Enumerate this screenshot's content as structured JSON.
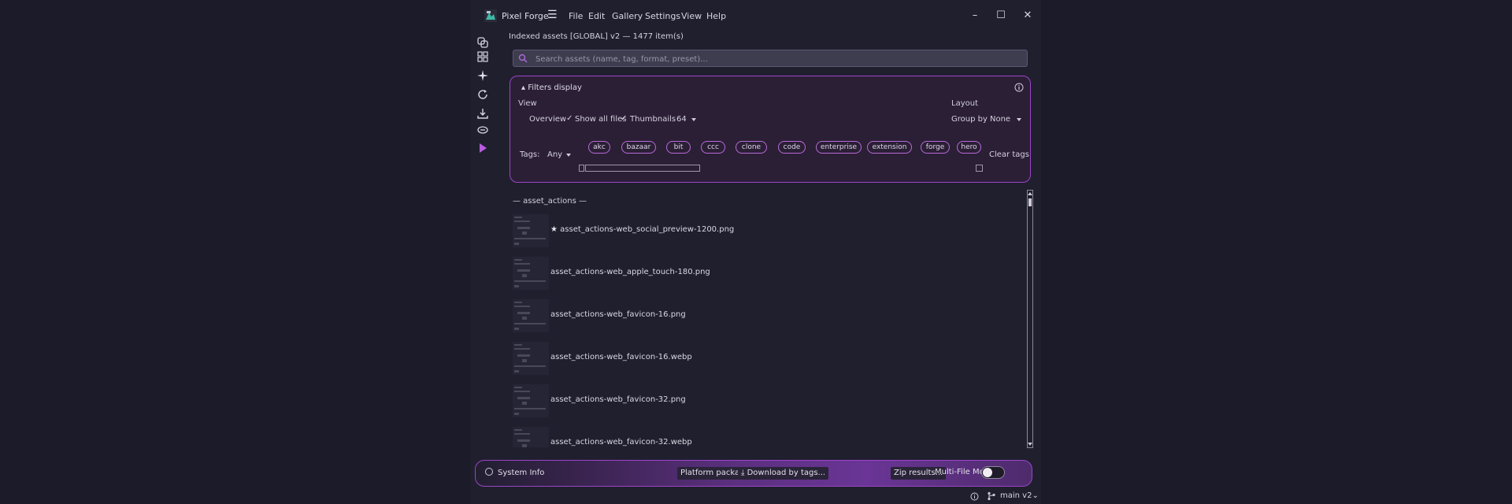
{
  "app": {
    "name": "Pixel Forge",
    "menu": [
      "File",
      "Edit",
      "Gallery",
      "Settings",
      "View",
      "Help"
    ],
    "window_controls": [
      "minimize",
      "maximize",
      "close"
    ]
  },
  "header": {
    "index_title": "Indexed assets [GLOBAL] v2 — 1477 item(s)"
  },
  "search": {
    "placeholder": "Search assets (name, tag, format, preset)...",
    "value": ""
  },
  "filters": {
    "toggle_label": "▴ Filters display",
    "view_label": "View",
    "overview_label": "Overview",
    "show_all_files_label": "Show all files",
    "show_all_files_checked": true,
    "thumbnails_label": "Thumbnails",
    "thumbnails_checked": true,
    "thumbnail_size": "64",
    "layout_label": "Layout",
    "group_by_label": "Group by",
    "group_by_value": "None",
    "tags_label": "Tags:",
    "tags_mode": "Any",
    "tags": [
      "akc",
      "bazaar",
      "bit",
      "ccc",
      "clone",
      "code",
      "enterprise",
      "extension",
      "forge",
      "hero"
    ],
    "clear_tags_label": "Clear tags"
  },
  "list": {
    "section_label": "— asset_actions —",
    "items": [
      {
        "name": "asset_actions-web_social_preview-1200.png",
        "starred": true
      },
      {
        "name": "asset_actions-web_apple_touch-180.png",
        "starred": false
      },
      {
        "name": "asset_actions-web_favicon-16.png",
        "starred": false
      },
      {
        "name": "asset_actions-web_favicon-16.webp",
        "starred": false
      },
      {
        "name": "asset_actions-web_favicon-32.png",
        "starred": false
      },
      {
        "name": "asset_actions-web_favicon-32.webp",
        "starred": false
      }
    ]
  },
  "bottombar": {
    "system_info_label": "System Info",
    "platform_package_label": "Platform package...",
    "download_by_tags_label": "Download by tags...",
    "zip_results_label": "Zip results...",
    "multi_file_mode_label": "Multi-File Mode",
    "multi_file_mode_on": false
  },
  "status": {
    "branch_label": "main v2⌄"
  },
  "colors": {
    "accent": "#9a45c8",
    "background": "#1c1b29",
    "panel": "#201f2e",
    "filters_bg": "#2b1f36"
  }
}
